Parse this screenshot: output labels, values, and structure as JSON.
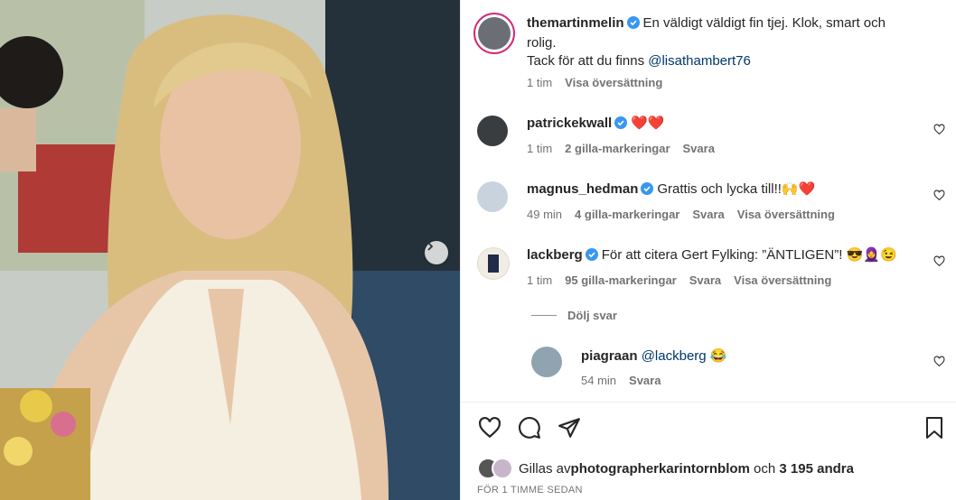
{
  "photo": {
    "next_button_icon": "chevron-right-icon"
  },
  "caption": {
    "username": "themartinmelin",
    "text_line1": "En väldigt väldigt fin tjej. Klok, smart och",
    "text_line2": "rolig.",
    "text_line3_prefix": "Tack för att du finns ",
    "mention": "@lisathambert76",
    "time": "1 tim",
    "translate": "Visa översättning"
  },
  "comments": [
    {
      "username": "patrickekwall",
      "text": "❤️❤️",
      "time": "1 tim",
      "likes": "2 gilla-markeringar",
      "reply": "Svara",
      "translate": ""
    },
    {
      "username": "magnus_hedman",
      "text": "Grattis och lycka till!!🙌❤️",
      "time": "49 min",
      "likes": "4 gilla-markeringar",
      "reply": "Svara",
      "translate": "Visa översättning"
    },
    {
      "username": "lackberg",
      "text": "För att citera Gert Fylking: ”ÄNTLIGEN”! 😎🧕😉",
      "time": "1 tim",
      "likes": "95 gilla-markeringar",
      "reply": "Svara",
      "translate": "Visa översättning"
    }
  ],
  "hide_replies": "Dölj svar",
  "reply": {
    "username": "piagraan",
    "mention": "@lackberg",
    "emoji": "😂",
    "time": "54 min",
    "reply": "Svara"
  },
  "likes": {
    "prefix": "Gillas av ",
    "user": "photographerkarintornblom",
    "middle": " och ",
    "count": "3 195 andra"
  },
  "timestamp": "FÖR 1 TIMME SEDAN",
  "colors": {
    "verified": "#3897f0",
    "mention": "#00376b",
    "muted": "#737373"
  }
}
